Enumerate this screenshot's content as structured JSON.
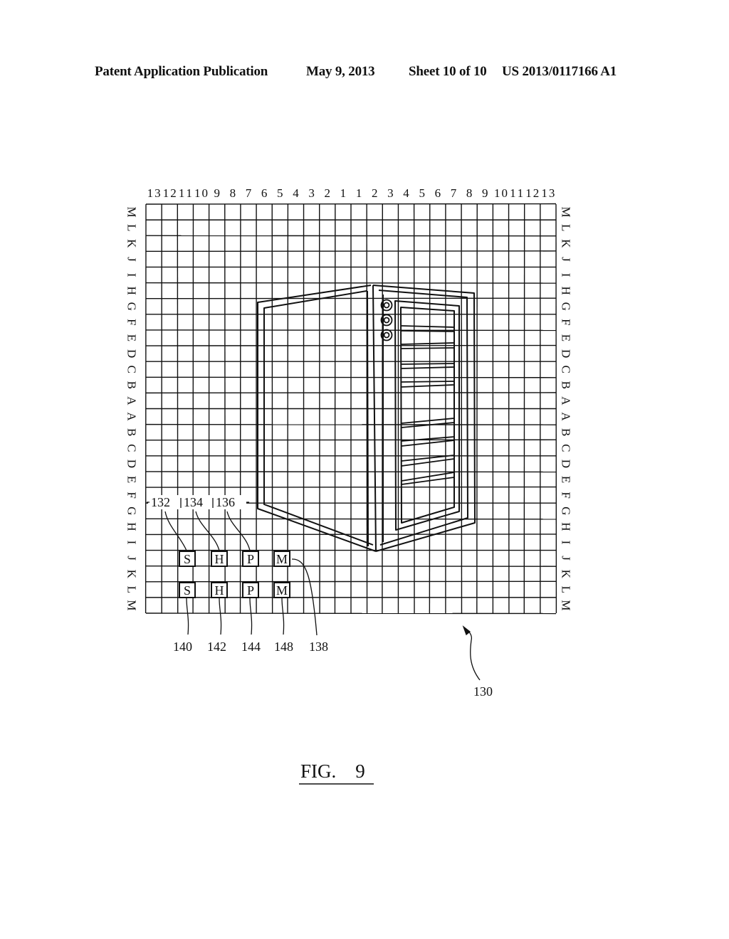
{
  "header": {
    "publication": "Patent Application Publication",
    "date": "May 9, 2013",
    "sheet": "Sheet 10 of 10",
    "number": "US 2013/0117166 A1"
  },
  "grid": {
    "column_labels": [
      "13",
      "12",
      "11",
      "10",
      "9",
      "8",
      "7",
      "6",
      "5",
      "4",
      "3",
      "2",
      "1",
      "1",
      "2",
      "3",
      "4",
      "5",
      "6",
      "7",
      "8",
      "9",
      "10",
      "11",
      "12",
      "13"
    ],
    "row_labels": [
      "M",
      "L",
      "K",
      "J",
      "I",
      "H",
      "G",
      "F",
      "E",
      "D",
      "C",
      "B",
      "A",
      "A",
      "B",
      "C",
      "D",
      "E",
      "F",
      "G",
      "H",
      "I",
      "J",
      "K",
      "L",
      "M"
    ]
  },
  "references": {
    "top": [
      "132",
      "134",
      "136"
    ],
    "bottom": [
      "140",
      "142",
      "144",
      "148",
      "138"
    ],
    "assembly": "130"
  },
  "boxes": {
    "row1": [
      "S",
      "H",
      "P",
      "M"
    ],
    "row2": [
      "S",
      "H",
      "P",
      "M"
    ]
  },
  "caption": "FIG.    9"
}
